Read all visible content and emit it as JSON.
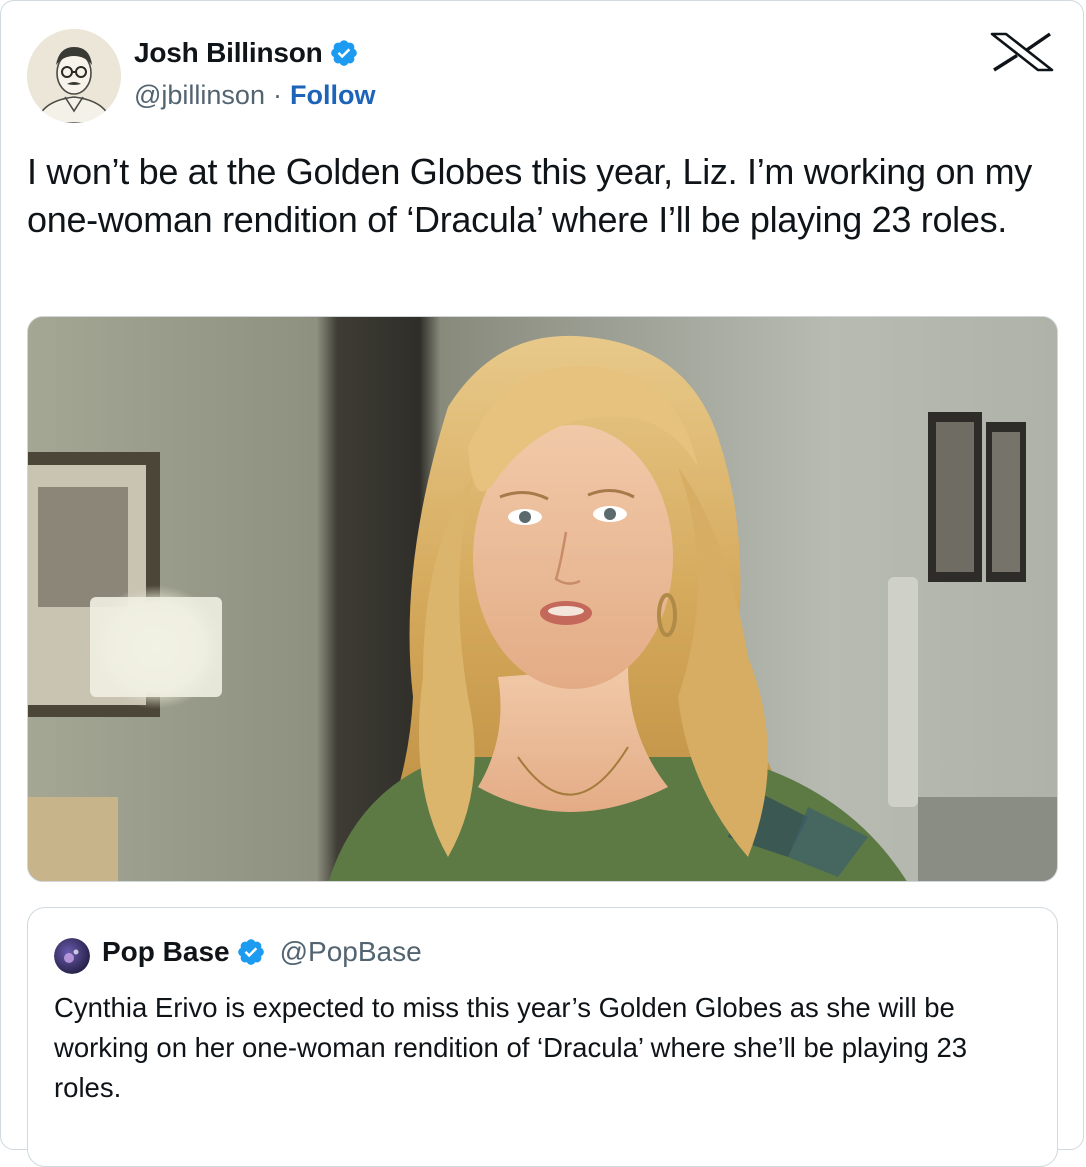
{
  "tweet": {
    "author_name": "Josh Billinson",
    "author_handle": "@jbillinson",
    "separator": "·",
    "follow_label": "Follow",
    "text": "I won’t be at the Golden Globes this year, Liz. I’m working on my one-woman rendition of ‘Dracula’ where I’ll be playing 23 roles.",
    "media": "photo of a woman with long blonde wavy hair in an office hallway"
  },
  "quoted_tweet": {
    "author_name": "Pop Base",
    "author_handle": "@PopBase",
    "text": "Cynthia Erivo is expected to miss this year’s Golden Globes as she will be working on her one-woman rendition of ‘Dracula’ where she’ll be playing 23 roles."
  },
  "icons": {
    "verified": "verified-badge-icon",
    "logo": "x-logo-icon"
  },
  "colors": {
    "verified": "#1d9bf0",
    "follow": "#1d63b8",
    "secondary_text": "#536471",
    "border": "#cfd9de"
  }
}
